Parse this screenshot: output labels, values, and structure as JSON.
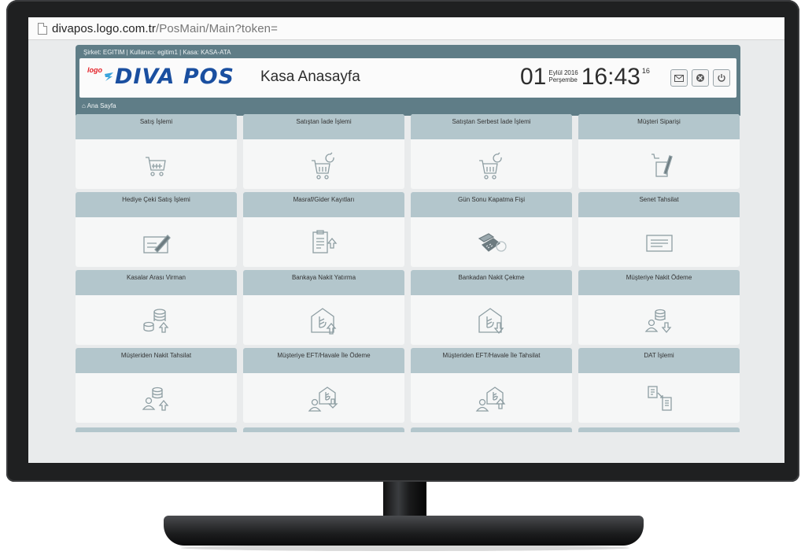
{
  "browser": {
    "url_domain": "divapos.logo.com.tr",
    "url_path": "/PosMain/Main?token="
  },
  "header": {
    "info_line": "Şirket: EGITIM  |  Kullanıcı: egitim1  |  Kasa: KASA-ATA",
    "logo_small": "logo",
    "logo_text": "DIVA POS",
    "page_title": "Kasa Anasayfa",
    "day": "01",
    "month_year": "Eylül 2016",
    "weekday": "Perşembe",
    "time": "16:43",
    "seconds": "16",
    "breadcrumb": "Ana Sayfa",
    "icons": [
      "mail-icon",
      "settings-icon",
      "power-icon"
    ]
  },
  "tiles": [
    {
      "label": "Satış İşlemi",
      "icon": "cart-icon"
    },
    {
      "label": "Satıştan İade İşlemi",
      "icon": "cart-return-icon"
    },
    {
      "label": "Satıştan Serbest İade İşlemi",
      "icon": "cart-return-icon"
    },
    {
      "label": "Müşteri Siparişi",
      "icon": "order-pen-icon"
    },
    {
      "label": "Hediye Çeki Satış İşlemi",
      "icon": "gift-check-icon"
    },
    {
      "label": "Masraf/Gider Kayıtları",
      "icon": "clipboard-up-icon"
    },
    {
      "label": "Gün Sonu Kapatma Fişi",
      "icon": "pos-terminal-icon"
    },
    {
      "label": "Senet Tahsilat",
      "icon": "note-icon"
    },
    {
      "label": "Kasalar Arası Virman",
      "icon": "database-transfer-icon"
    },
    {
      "label": "Bankaya Nakit Yatırma",
      "icon": "bank-deposit-icon"
    },
    {
      "label": "Bankadan Nakit Çekme",
      "icon": "bank-withdraw-icon"
    },
    {
      "label": "Müşteriye Nakit Ödeme",
      "icon": "person-down-icon"
    },
    {
      "label": "Müşteriden Nakit Tahsilat",
      "icon": "person-up-icon"
    },
    {
      "label": "Müşteriye EFT/Havale İle Ödeme",
      "icon": "person-bank-down-icon"
    },
    {
      "label": "Müşteriden EFT/Havale İle Tahsilat",
      "icon": "person-bank-up-icon"
    },
    {
      "label": "DAT İşlemi",
      "icon": "document-transfer-icon"
    }
  ],
  "colors": {
    "header_bg": "#5f7d87",
    "tile_header": "#b3c6cc",
    "icon_stroke": "#8e9ea3",
    "logo_red": "#e31f26",
    "logo_blue": "#1a4fa0"
  }
}
